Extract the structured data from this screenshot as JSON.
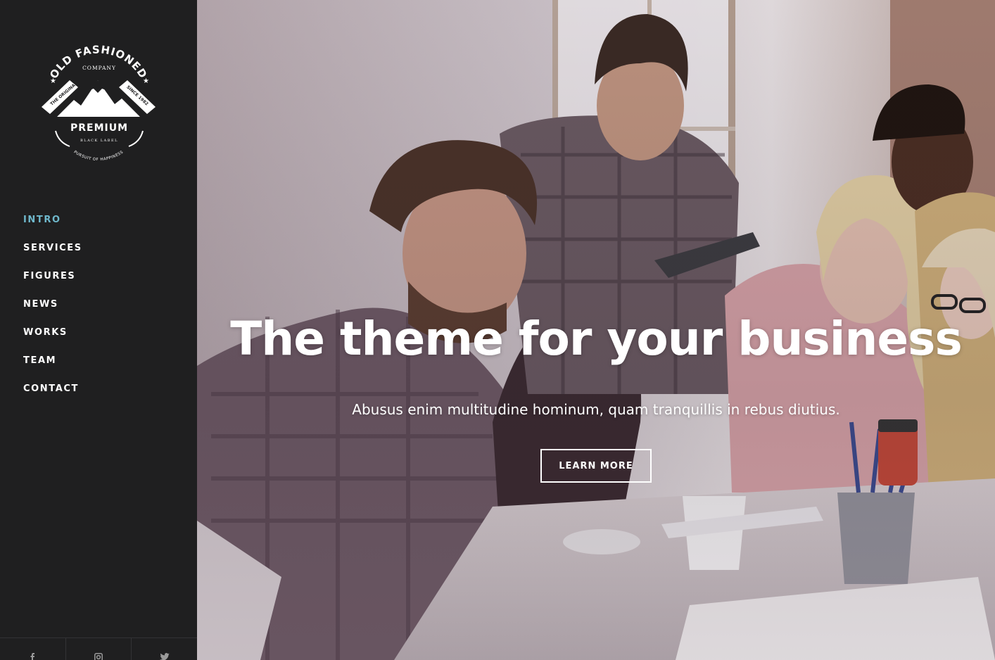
{
  "logo": {
    "arc_text": "OLD FASHIONED",
    "company": "COMPANY",
    "left_ribbon": "THE ORIGINAL",
    "right_ribbon": "SINCE 1982",
    "main_label": "PREMIUM",
    "sub_label": "BLACK LABEL",
    "bottom_text": "PURSUIT OF HAPPINESS"
  },
  "nav": {
    "items": [
      {
        "label": "INTRO",
        "active": true
      },
      {
        "label": "SERVICES"
      },
      {
        "label": "FIGURES"
      },
      {
        "label": "NEWS"
      },
      {
        "label": "WORKS"
      },
      {
        "label": "TEAM"
      },
      {
        "label": "CONTACT"
      }
    ]
  },
  "social": {
    "icons": [
      "facebook-icon",
      "instagram-icon",
      "twitter-icon"
    ]
  },
  "hero": {
    "title": "The theme for your business",
    "subtitle": "Abusus enim multitudine hominum, quam tranquillis in rebus diutius.",
    "button_label": "LEARN MORE"
  },
  "colors": {
    "sidebar_bg": "#1f1f20",
    "active_nav": "#6fb8cc",
    "text": "#ffffff"
  }
}
